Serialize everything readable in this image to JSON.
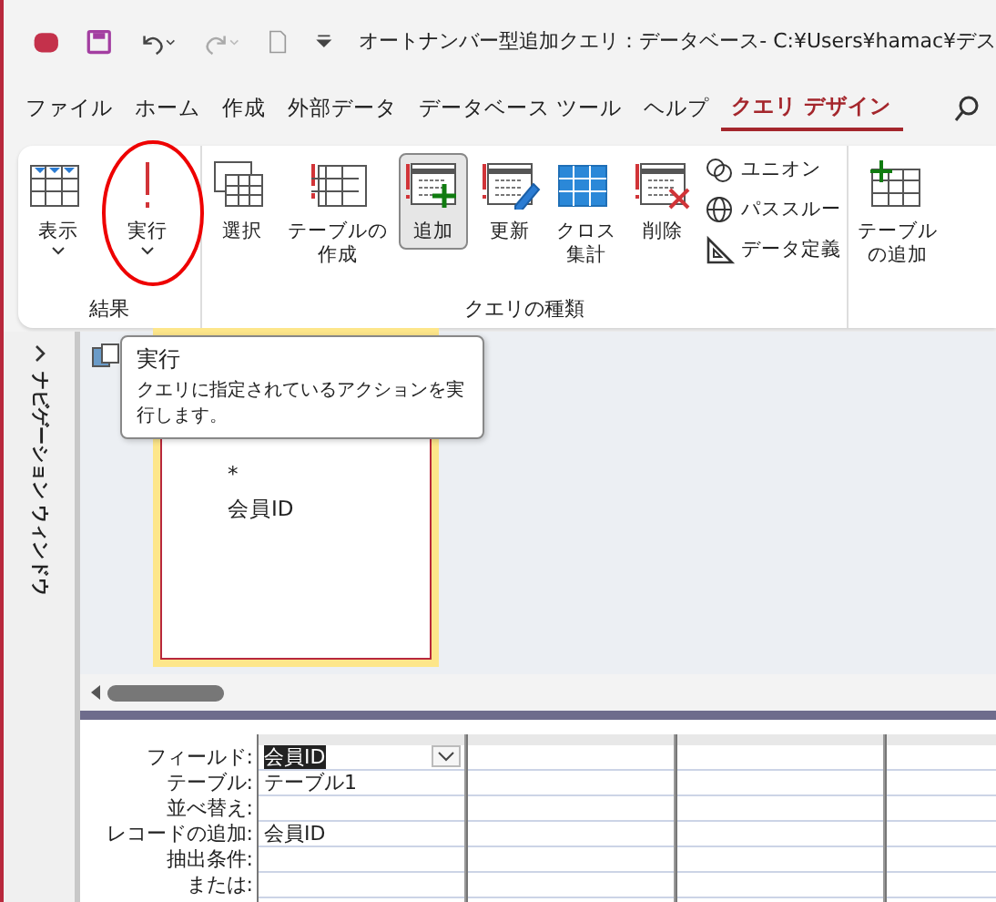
{
  "title_bar": {
    "title": "オートナンバー型追加クエリ：データベース- C:¥Users¥hamac¥デス"
  },
  "menu_tabs": [
    {
      "label": "ファイル",
      "selected": false
    },
    {
      "label": "ホーム",
      "selected": false
    },
    {
      "label": "作成",
      "selected": false
    },
    {
      "label": "外部データ",
      "selected": false
    },
    {
      "label": "データベース ツール",
      "selected": false
    },
    {
      "label": "ヘルプ",
      "selected": false
    },
    {
      "label": "クエリ デザイン",
      "selected": true
    }
  ],
  "ribbon": {
    "groups": [
      {
        "label": "結果",
        "buttons": [
          {
            "kind": "large",
            "label_lines": [
              "表示"
            ],
            "dropdown": true,
            "selected": false,
            "highlighted": false
          },
          {
            "kind": "large",
            "label_lines": [
              "実行"
            ],
            "dropdown": true,
            "selected": false,
            "highlighted": true
          }
        ]
      },
      {
        "label": "クエリの種類",
        "buttons": [
          {
            "kind": "large",
            "label_lines": [
              "選択"
            ],
            "selected": false
          },
          {
            "kind": "large",
            "label_lines": [
              "テーブルの",
              "作成"
            ],
            "selected": false
          },
          {
            "kind": "large",
            "label_lines": [
              "追加"
            ],
            "selected": true
          },
          {
            "kind": "large",
            "label_lines": [
              "更新"
            ],
            "selected": false
          },
          {
            "kind": "large",
            "label_lines": [
              "クロス",
              "集計"
            ],
            "selected": false
          },
          {
            "kind": "large",
            "label_lines": [
              "削除"
            ],
            "selected": false
          },
          {
            "kind": "small",
            "label_lines": [
              "ユニオン"
            ],
            "selected": false
          },
          {
            "kind": "small",
            "label_lines": [
              "パススルー"
            ],
            "selected": false
          },
          {
            "kind": "small",
            "label_lines": [
              "データ定義"
            ],
            "selected": false
          }
        ]
      },
      {
        "buttons": [
          {
            "kind": "large",
            "label_lines": [
              "テーブル",
              "の追加"
            ],
            "selected": false
          }
        ]
      }
    ]
  },
  "tooltip": {
    "title": "実行",
    "text": "クエリに指定されているアクションを実行します。"
  },
  "nav_pane": {
    "label": "ナビゲーション ウィンドウ"
  },
  "query_table": {
    "fields": [
      "*",
      "会員ID"
    ]
  },
  "grid": {
    "row_labels": [
      "フィールド:",
      "テーブル:",
      "並べ替え:",
      "レコードの追加:",
      "抽出条件:",
      "または:"
    ],
    "columns": [
      {
        "cells": [
          {
            "text": "会員ID",
            "selected": true
          },
          {
            "text": "テーブル1",
            "selected": false
          },
          {
            "selected": false
          },
          {
            "text": "会員ID",
            "selected": false
          },
          {
            "selected": false
          },
          {
            "selected": false
          }
        ]
      }
    ]
  }
}
